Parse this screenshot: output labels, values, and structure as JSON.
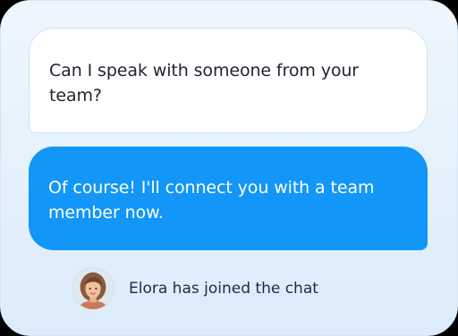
{
  "chat": {
    "user_message": "Can I speak with someone from your team?",
    "agent_message": "Of course! I'll connect you with a team member now.",
    "system_notice": "Elora has joined the chat",
    "agent_avatar_icon": "agent-avatar"
  },
  "colors": {
    "panel_background": "#e8f3fc",
    "user_bubble": "#ffffff",
    "agent_bubble": "#1296f7",
    "notice_text": "#1d2a4a"
  }
}
